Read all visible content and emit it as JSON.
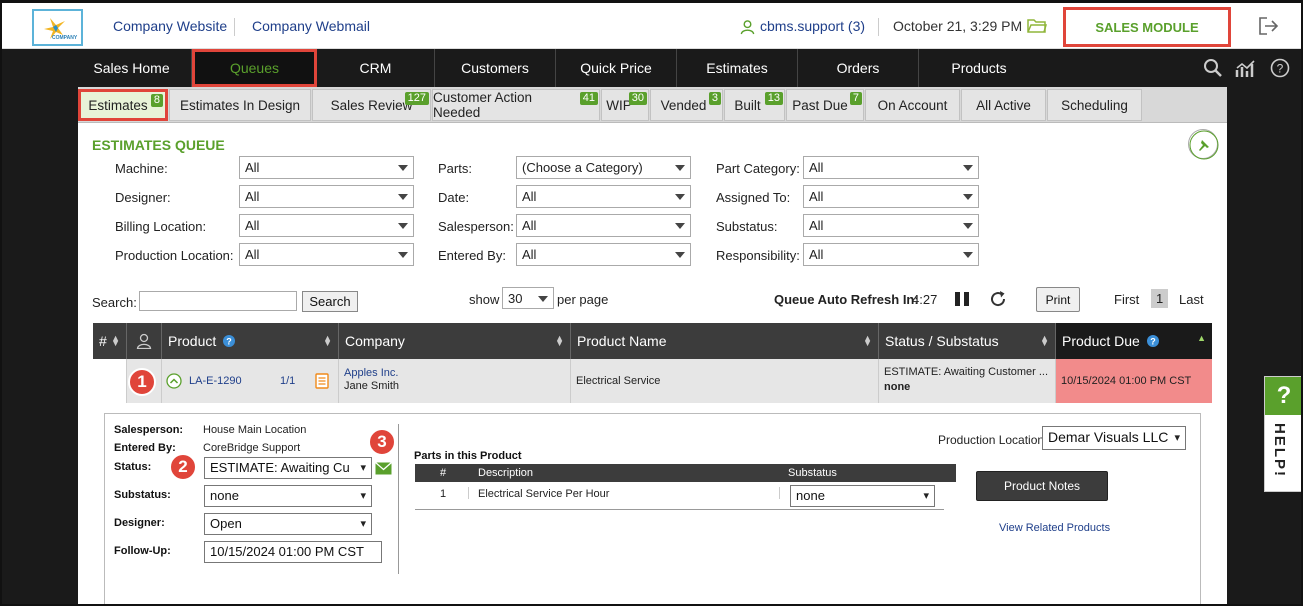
{
  "header": {
    "logo_text": "COMPANY",
    "links": [
      "Company Website",
      "Company Webmail"
    ],
    "user": "cbms.support (3)",
    "datetime": "October 21, 3:29 PM",
    "module": "SALES MODULE"
  },
  "nav": {
    "items": [
      "Sales Home",
      "Queues",
      "CRM",
      "Customers",
      "Quick Price",
      "Estimates",
      "Orders",
      "Products"
    ],
    "active": "Queues"
  },
  "subtabs": [
    {
      "label": "Estimates",
      "count": "8"
    },
    {
      "label": "Estimates In Design",
      "count": ""
    },
    {
      "label": "Sales Review",
      "count": "127"
    },
    {
      "label": "Customer Action Needed",
      "count": "41"
    },
    {
      "label": "WIP",
      "count": "30"
    },
    {
      "label": "Vended",
      "count": "3"
    },
    {
      "label": "Built",
      "count": "13"
    },
    {
      "label": "Past Due",
      "count": "7"
    },
    {
      "label": "On Account",
      "count": ""
    },
    {
      "label": "All Active",
      "count": ""
    },
    {
      "label": "Scheduling",
      "count": ""
    }
  ],
  "queue": {
    "title": "ESTIMATES QUEUE",
    "filters": {
      "machine": {
        "label": "Machine:",
        "value": "All"
      },
      "designer": {
        "label": "Designer:",
        "value": "All"
      },
      "billing_location": {
        "label": "Billing Location:",
        "value": "All"
      },
      "production_location": {
        "label": "Production Location:",
        "value": "All"
      },
      "parts": {
        "label": "Parts:",
        "value": "(Choose a Category)"
      },
      "date": {
        "label": "Date:",
        "value": "All"
      },
      "salesperson": {
        "label": "Salesperson:",
        "value": "All"
      },
      "entered_by": {
        "label": "Entered By:",
        "value": "All"
      },
      "part_category": {
        "label": "Part Category:",
        "value": "All"
      },
      "assigned_to": {
        "label": "Assigned To:",
        "value": "All"
      },
      "substatus": {
        "label": "Substatus:",
        "value": "All"
      },
      "responsibility": {
        "label": "Responsibility:",
        "value": "All"
      }
    },
    "search_label": "Search:",
    "search_button": "Search",
    "show_label": "show",
    "per_page": "30",
    "per_page_label": "per page",
    "refresh_label": "Queue Auto Refresh In:",
    "refresh_time": "4:27",
    "print_button": "Print",
    "first": "First",
    "page": "1",
    "last": "Last"
  },
  "table": {
    "headers": [
      "#",
      "",
      "Product",
      "Company",
      "Product Name",
      "Status / Substatus",
      "Product Due"
    ],
    "row": {
      "product_id": "LA-E-1290",
      "fraction": "1/1",
      "company": "Apples Inc.",
      "contact": "Jane Smith",
      "product_name": "Electrical Service",
      "status": "ESTIMATE: Awaiting Customer ...",
      "substatus": "none",
      "due": "10/15/2024 01:00 PM CST"
    }
  },
  "detail": {
    "salesperson_label": "Salesperson:",
    "salesperson": "House Main Location",
    "entered_by_label": "Entered By:",
    "entered_by": "CoreBridge Support",
    "status_label": "Status:",
    "status": "ESTIMATE: Awaiting Cu",
    "substatus_label": "Substatus:",
    "substatus": "none",
    "designer_label": "Designer:",
    "designer": "Open",
    "followup_label": "Follow-Up:",
    "followup": "10/15/2024 01:00 PM CST",
    "parts_title": "Parts in this Product",
    "parts_headers": [
      "#",
      "Description",
      "Substatus"
    ],
    "part": {
      "num": "1",
      "description": "Electrical Service Per Hour",
      "substatus": "none"
    },
    "production_location_label": "Production Location:",
    "production_location": "Demar Visuals LLC",
    "notes_button": "Product Notes",
    "related_link": "View Related Products"
  },
  "badges": [
    "1",
    "2",
    "3"
  ],
  "help": {
    "q": "?",
    "label": "HELP!"
  },
  "colors": {
    "accent": "#5aa02c",
    "highlight": "#e0453a",
    "due_bg": "#f28b8b",
    "link": "#1f3f8a"
  }
}
